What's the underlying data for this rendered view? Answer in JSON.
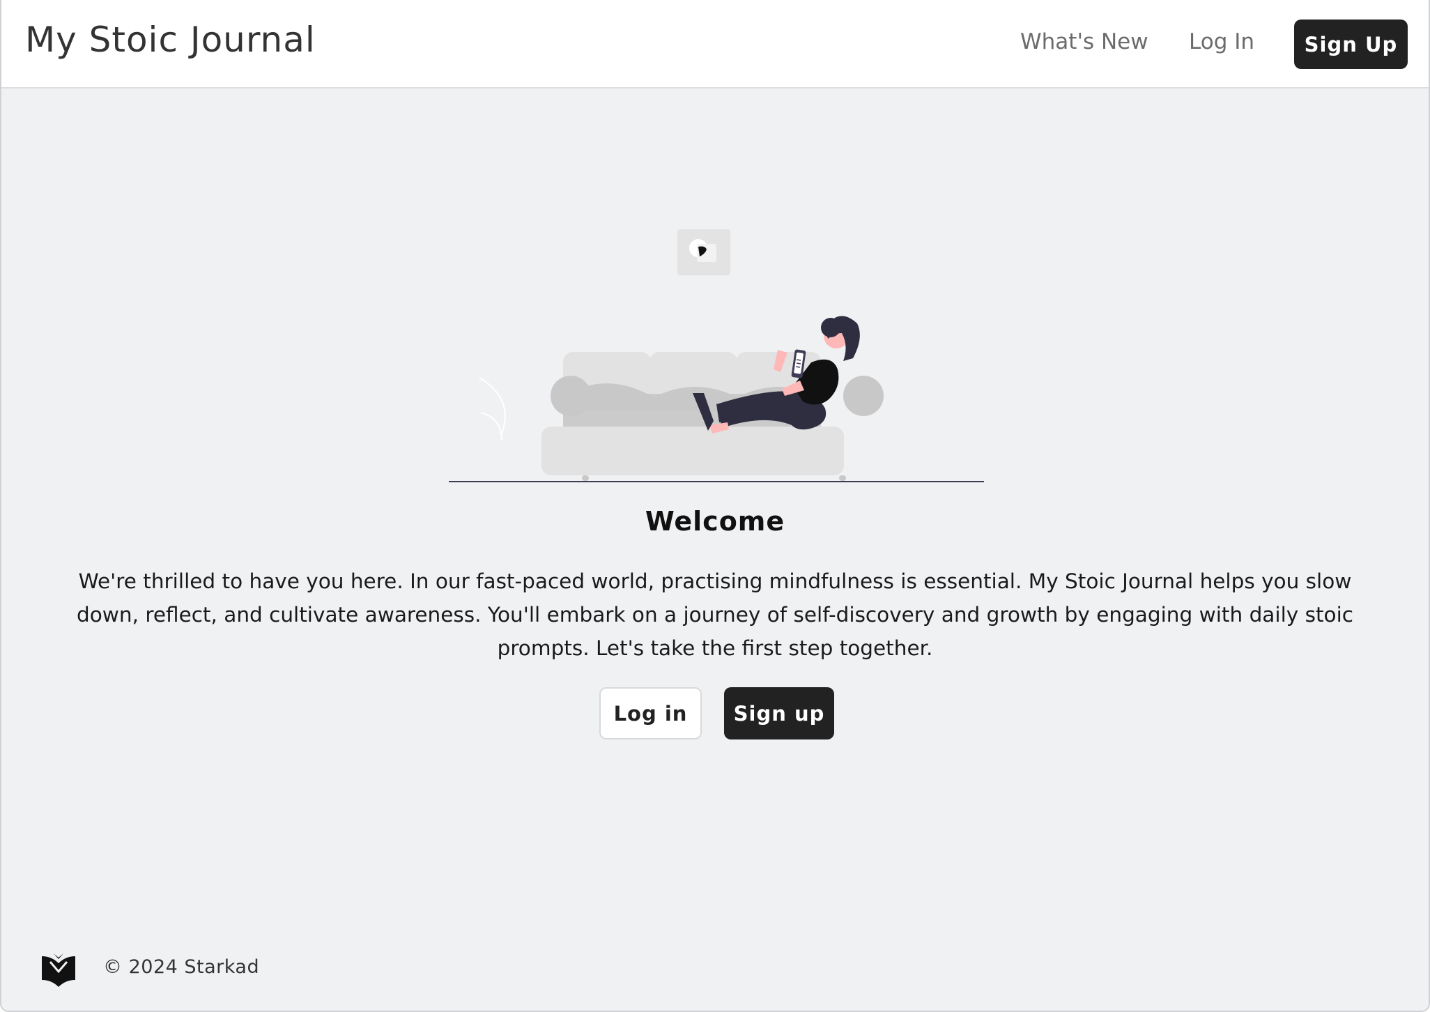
{
  "app": {
    "title": "My Stoic Journal"
  },
  "nav": {
    "whats_new": "What's New",
    "log_in": "Log In",
    "sign_up": "Sign Up"
  },
  "hero": {
    "title": "Welcome",
    "body": "We're thrilled to have you here. In our fast-paced world, practising mindfulness is essential. My Stoic Journal helps you slow down, reflect, and cultivate awareness. You'll embark on a journey of self-discovery and growth by engaging with daily stoic prompts. Let's take the first step together.",
    "login_button": "Log in",
    "signup_button": "Sign up"
  },
  "footer": {
    "copyright": "© 2024 Starkad"
  },
  "icons": {
    "footer_logo": "book-heart-logo-icon",
    "illustration": "person-on-sofa-illustration"
  },
  "colors": {
    "primary": "#222222",
    "background": "#f0f1f3",
    "header_bg": "#ffffff"
  }
}
